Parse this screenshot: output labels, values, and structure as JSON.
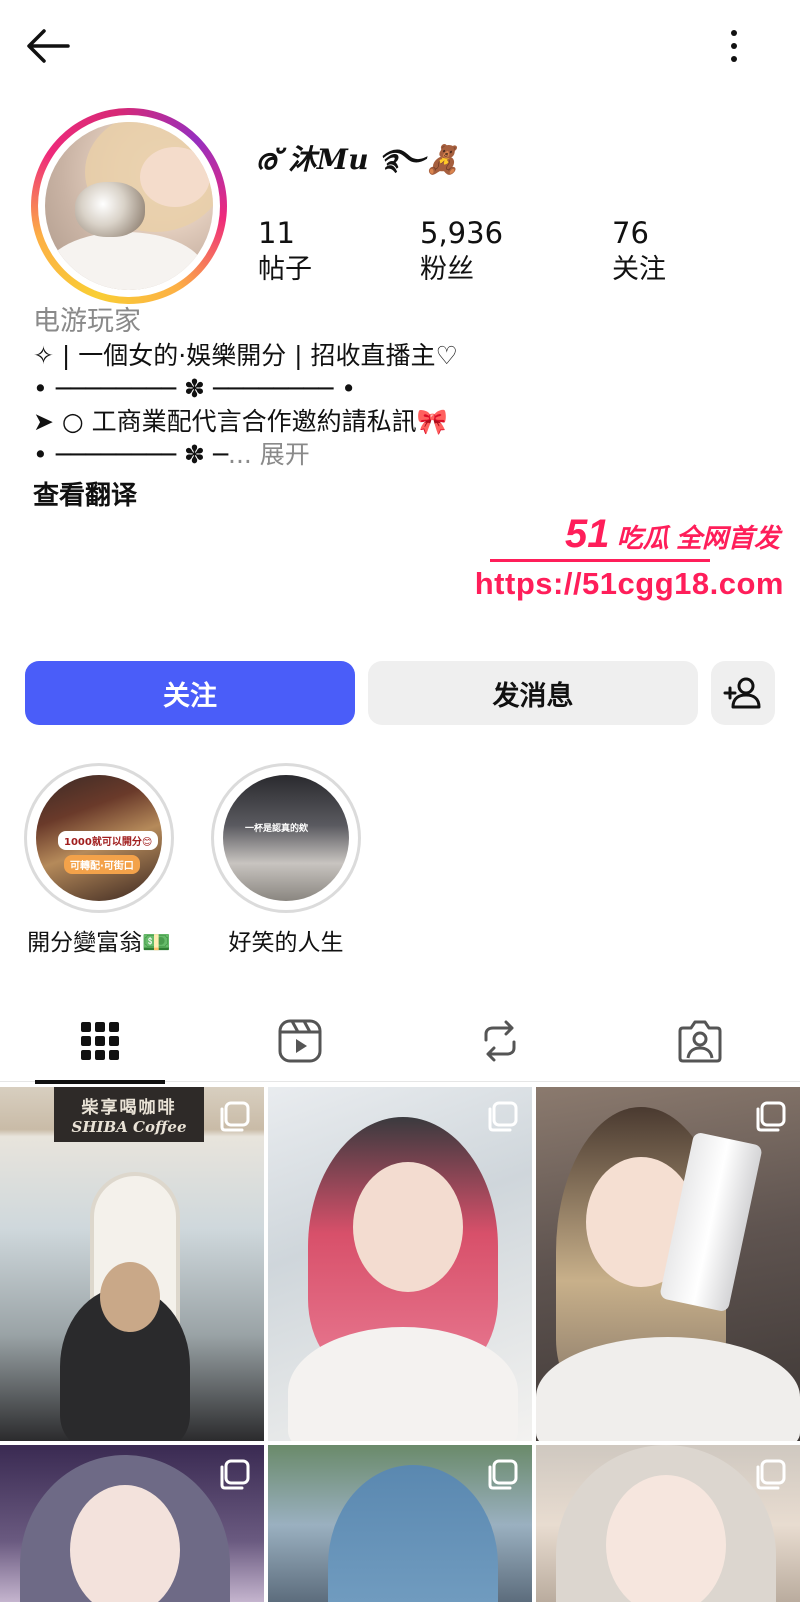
{
  "header": {
    "back_icon": "arrow-left-icon",
    "more_icon": "more-vertical-icon"
  },
  "profile": {
    "username": "ര് 沐Mu ࿐🧸",
    "stats": [
      {
        "value": "11",
        "label": "帖子"
      },
      {
        "value": "5,936",
        "label": "粉丝"
      },
      {
        "value": "76",
        "label": "关注"
      }
    ],
    "category": "电游玩家",
    "bio_lines": [
      "✧ | 一個女的·娛樂開分 | 招收直播主♡",
      "• ──────── ✽ ──────── •",
      "➤ ○ 工商業配代言合作邀約請私訊🎀",
      "• ──────── ✽ ─"
    ],
    "bio_ellipsis": "... ",
    "bio_more": "展开",
    "translate_label": "查看翻译"
  },
  "watermark": {
    "brand_number": "51",
    "brand_text": "吃瓜 全网首发",
    "url": "https://51cgg18.com"
  },
  "actions": {
    "follow_label": "关注",
    "message_label": "发消息",
    "add_user_icon": "add-person-icon"
  },
  "highlights": [
    {
      "label": "開分變富翁💵",
      "chip_1": "1000就可以開分😊",
      "chip_2": "可轉配·可街口"
    },
    {
      "label": "好笑的人生",
      "overlay_text": "一杯是認真的欸"
    }
  ],
  "tabs": [
    {
      "name": "grid",
      "icon": "grid-icon"
    },
    {
      "name": "reels",
      "icon": "reels-icon"
    },
    {
      "name": "reposts",
      "icon": "repost-icon"
    },
    {
      "name": "tagged",
      "icon": "tagged-person-icon"
    }
  ],
  "active_tab": "grid",
  "posts": [
    {
      "sign_line_1": "柴享喝咖啡",
      "sign_line_2": "SHIBA Coffee",
      "multi_icon": "carousel-icon"
    },
    {
      "multi_icon": "carousel-icon"
    },
    {
      "multi_icon": "carousel-icon"
    },
    {
      "multi_icon": "carousel-icon"
    },
    {
      "multi_icon": "carousel-icon"
    },
    {
      "multi_icon": "carousel-icon"
    }
  ],
  "colors": {
    "follow_button": "#4a5df9",
    "secondary_button": "#efefef",
    "watermark": "#ff1e5a",
    "muted_text": "#8a8a8a"
  }
}
